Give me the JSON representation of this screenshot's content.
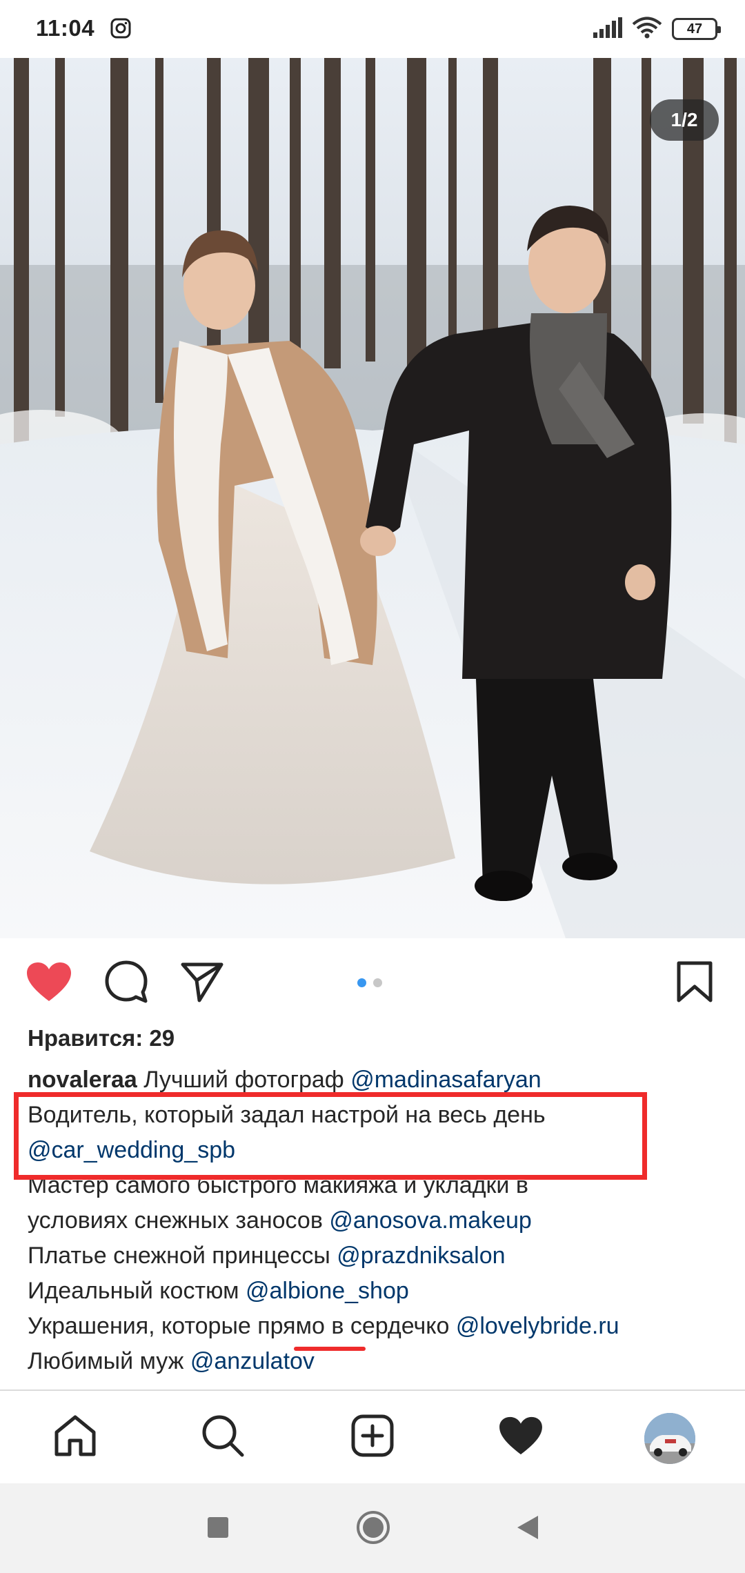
{
  "status_bar": {
    "time": "11:04",
    "battery": "47",
    "icons": [
      "instagram-icon",
      "signal-icon",
      "wifi-icon",
      "battery-icon"
    ]
  },
  "post": {
    "photo_counter": "1/2",
    "carousel": {
      "total": 2,
      "active_index": 0
    },
    "likes_label": "Нравится: 29",
    "caption": {
      "username": "novaleraa",
      "lines": [
        {
          "text": "Лучший фотограф ",
          "mention": "@madinasafaryan"
        },
        {
          "text": "Водитель, который задал настрой на весь день",
          "mention": ""
        },
        {
          "text": "",
          "mention": "@car_wedding_spb"
        },
        {
          "text": "Мастер самого быстрого макияжа и укладки в",
          "mention": ""
        },
        {
          "text": "условиях снежных заносов ",
          "mention": "@anosova.makeup"
        },
        {
          "text": "Платье снежной принцессы ",
          "mention": "@prazdniksalon"
        },
        {
          "text": "Идеальный костюм ",
          "mention": "@albione_shop"
        },
        {
          "text": "Украшения, которые прямо в сердечко ",
          "mention": "@lovelybride.ru"
        },
        {
          "text": "Любимый муж ",
          "mention": "@anzulatov"
        }
      ]
    }
  },
  "actions": [
    "heart-filled-icon",
    "comment-icon",
    "share-icon",
    "bookmark-icon"
  ],
  "bottom_nav": [
    "home-icon",
    "search-icon",
    "add-post-icon",
    "activity-heart-icon",
    "profile-avatar"
  ],
  "system_nav": [
    "recents-square-icon",
    "home-circle-icon",
    "back-triangle-icon"
  ],
  "colors": {
    "like_red": "#ed4956",
    "mention_blue": "#00376b",
    "dot_active": "#3897f0",
    "annotation_red": "#ef2b2b"
  }
}
